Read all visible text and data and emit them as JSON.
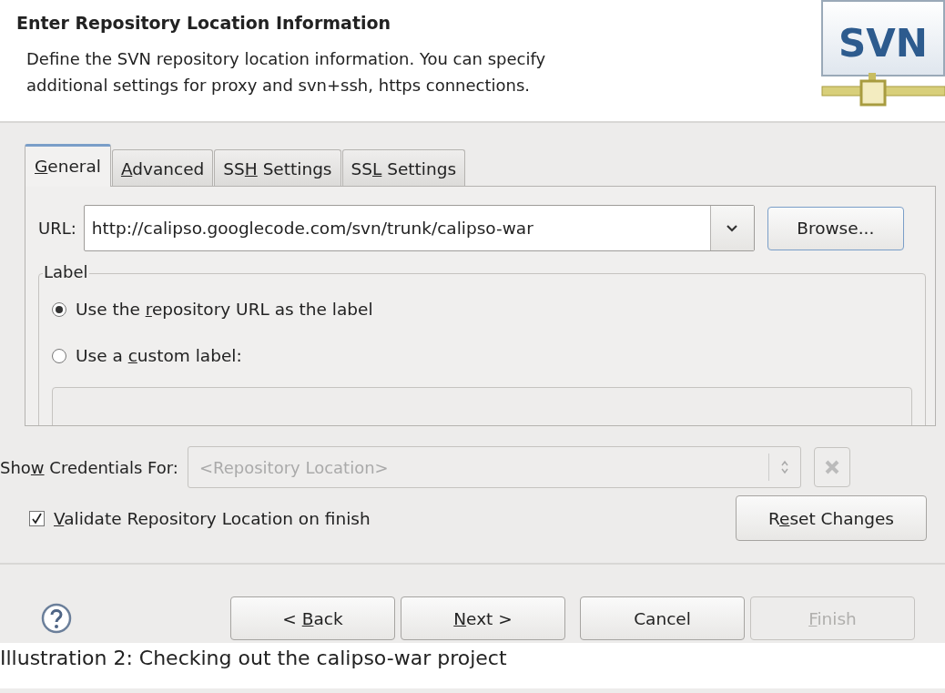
{
  "header": {
    "title": "Enter Repository Location Information",
    "description": "Define the SVN repository location information. You can specify additional settings for proxy and svn+ssh, https connections.",
    "logo_text": "SVN"
  },
  "tabs": [
    {
      "label": [
        {
          "text": "G",
          "underlined": true
        },
        {
          "text": "eneral",
          "underlined": false
        }
      ],
      "selected": true
    },
    {
      "label": [
        {
          "text": "A",
          "underlined": true
        },
        {
          "text": "dvanced",
          "underlined": false
        }
      ],
      "selected": false
    },
    {
      "label": [
        {
          "text": "SS",
          "underlined": false
        },
        {
          "text": "H",
          "underlined": true
        },
        {
          "text": " Settings",
          "underlined": false
        }
      ],
      "selected": false
    },
    {
      "label": [
        {
          "text": "SS",
          "underlined": false
        },
        {
          "text": "L",
          "underlined": true
        },
        {
          "text": " Settings",
          "underlined": false
        }
      ],
      "selected": false
    }
  ],
  "url": {
    "label": "URL:",
    "value": "http://calipso.googlecode.com/svn/trunk/calipso-war",
    "browse": "Browse..."
  },
  "label_group": {
    "title": "Label",
    "options": [
      {
        "label": [
          {
            "text": "Use the ",
            "underlined": false
          },
          {
            "text": "r",
            "underlined": true
          },
          {
            "text": "epository URL as the label",
            "underlined": false
          }
        ],
        "selected": true
      },
      {
        "label": [
          {
            "text": "Use a ",
            "underlined": false
          },
          {
            "text": "c",
            "underlined": true
          },
          {
            "text": "ustom label:",
            "underlined": false
          }
        ],
        "selected": false
      }
    ]
  },
  "credentials": {
    "label": [
      {
        "text": "Sho",
        "underlined": false
      },
      {
        "text": "w",
        "underlined": true
      },
      {
        "text": " Credentials For:",
        "underlined": false
      }
    ],
    "placeholder": "<Repository Location>",
    "disabled": true
  },
  "validate": {
    "label": [
      {
        "text": "V",
        "underlined": true
      },
      {
        "text": "alidate Repository Location on finish",
        "underlined": false
      }
    ],
    "checked": true
  },
  "reset_button": [
    {
      "text": "R",
      "underlined": false
    },
    {
      "text": "e",
      "underlined": true
    },
    {
      "text": "set Changes",
      "underlined": false
    }
  ],
  "buttons": [
    {
      "label": [
        {
          "text": "< ",
          "underlined": false
        },
        {
          "text": "B",
          "underlined": true
        },
        {
          "text": "ack",
          "underlined": false
        }
      ],
      "disabled": false
    },
    {
      "label": [
        {
          "text": "N",
          "underlined": true
        },
        {
          "text": "ext >",
          "underlined": false
        }
      ],
      "disabled": false
    },
    {
      "label": [
        {
          "text": "Cancel",
          "underlined": false
        }
      ],
      "disabled": false
    },
    {
      "label": [
        {
          "text": "F",
          "underlined": true
        },
        {
          "text": "inish",
          "underlined": false
        }
      ],
      "disabled": true
    }
  ],
  "caption": "Illustration 2: Checking out the calipso-war project"
}
